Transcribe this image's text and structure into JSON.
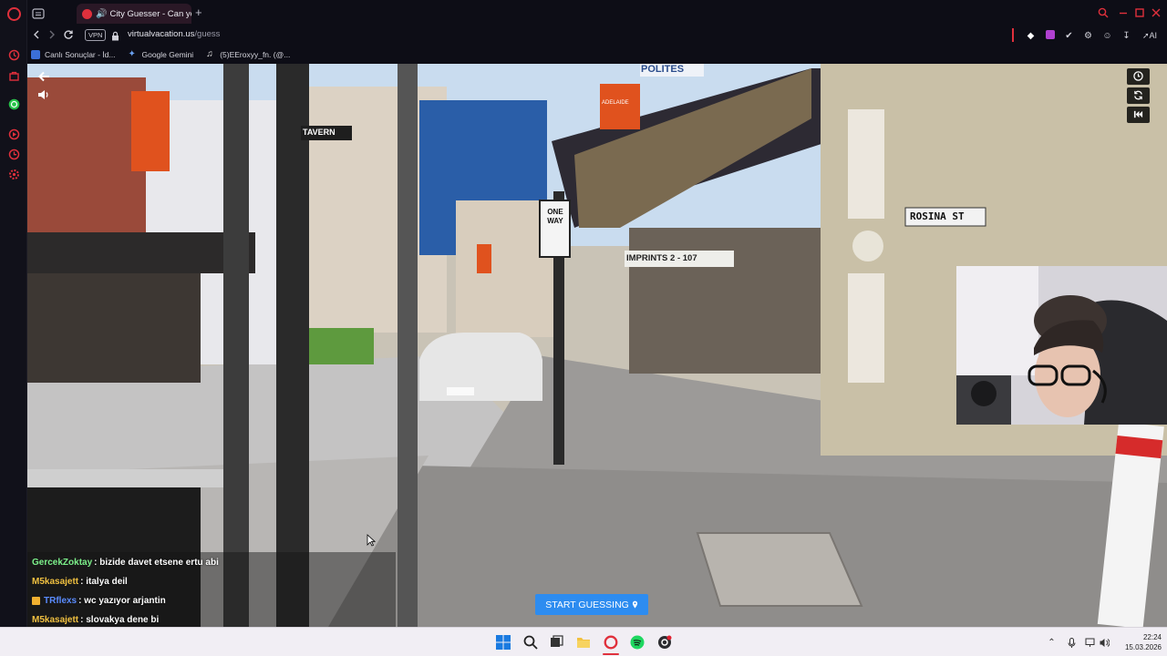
{
  "browser": {
    "tab_title": "City Guesser - Can you",
    "new_tab": "+",
    "vpn": "VPN",
    "url_host": "virtualvacation.us",
    "url_path": "/guess",
    "ai_label": "AI",
    "accent": "#e0303c"
  },
  "bookmarks": [
    {
      "label": "Canlı Sonuçlar - İd...",
      "icon_color": "#3b6fd8"
    },
    {
      "label": "Google Gemini",
      "icon_color": "#6aa0f0"
    },
    {
      "label": "(5)EEroxyy_fn. (@...",
      "icon_color": "#e8e8e8"
    }
  ],
  "video": {
    "sign_rosina": "ROSINA ST",
    "sign_one_way": "ONE WAY",
    "sign_tavern": "TAVERN",
    "sign_imprints": "IMPRINTS 2 - 107",
    "sign_polites": "POLITES",
    "sign_adelaide": "ADELAIDE"
  },
  "chat": [
    {
      "user": "GercekZoktay",
      "msg": ": bizide davet etsene ertu abi",
      "color": "#7cf08a",
      "badge": false
    },
    {
      "user": "M5kasajett",
      "msg": ": italya deil",
      "color": "#f0c040",
      "badge": false
    },
    {
      "user": "TRflexs",
      "msg": ": wc yazıyor arjantin",
      "color": "#5a8cff",
      "badge": true
    },
    {
      "user": "M5kasajett",
      "msg": ": slovakya dene bi",
      "color": "#f0c040",
      "badge": false
    }
  ],
  "start_button": "START GUESSING",
  "taskbar": {
    "time": "22:24",
    "date": "15.03.2026"
  }
}
